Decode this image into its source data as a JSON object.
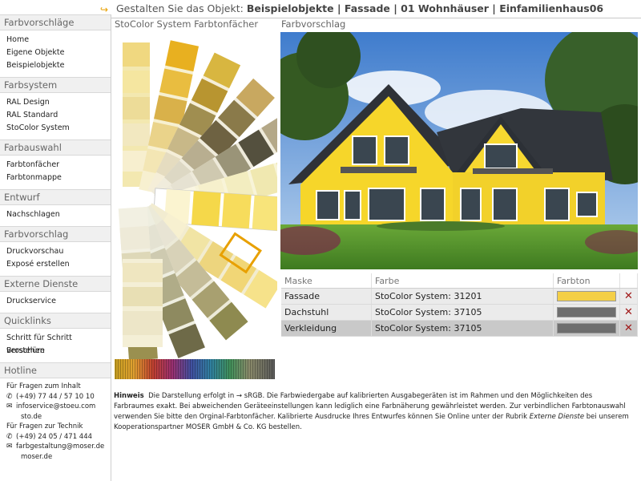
{
  "header": {
    "logo_icon": "arrow-link-icon",
    "title_prefix": "Gestalten Sie das Objekt: ",
    "title_path": "Beispielobjekte | Fassade | 01 Wohnhäuser | Einfamilienhaus06"
  },
  "sidebar": {
    "sections": [
      {
        "title": "Farbvorschläge",
        "items": [
          "Home",
          "Eigene Objekte",
          "Beispielobjekte"
        ]
      },
      {
        "title": "Farbsystem",
        "items": [
          "RAL Design",
          "RAL Standard",
          "StoColor System"
        ]
      },
      {
        "title": "Farbauswahl",
        "items": [
          "Farbtonfächer",
          "Farbtonmappe"
        ]
      },
      {
        "title": "Entwurf",
        "items": [
          "Nachschlagen"
        ]
      },
      {
        "title": "Farbvorschlag",
        "items": [
          "Druckvorschau",
          "Exposé erstellen"
        ]
      },
      {
        "title": "Externe Dienste",
        "items": [
          "Druckservice"
        ]
      },
      {
        "title": "Quicklinks",
        "items": [
          "Schritt für Schritt verstehen",
          "Broschüre"
        ]
      }
    ],
    "hotline": {
      "title": "Hotline",
      "content_label": "Für Fragen zum Inhalt",
      "content_phone": "(+49) 77 44 / 57 10 10",
      "content_email_1": "infoservice@stoeu.com",
      "content_email_2": "sto.de",
      "tech_label": "Für Fragen zur Technik",
      "tech_phone": "(+49) 24 05 / 471 444",
      "tech_email_1": "farbgestaltung@moser.de",
      "tech_email_2": "moser.de"
    }
  },
  "fan_panel": {
    "title": "StoColor System Farbtonfächer"
  },
  "preview": {
    "title": "Farbvorschlag"
  },
  "mask_table": {
    "headers": [
      "Maske",
      "Farbe",
      "Farbton",
      ""
    ],
    "rows": [
      {
        "mask": "Fassade",
        "color": "StoColor System: 31201",
        "swatch": "#f4cf47"
      },
      {
        "mask": "Dachstuhl",
        "color": "StoColor System: 37105",
        "swatch": "#6e6e6e"
      },
      {
        "mask": "Verkleidung",
        "color": "StoColor System: 37105",
        "swatch": "#6e6e6e"
      }
    ],
    "delete_icon": "close-x-icon"
  },
  "hint": {
    "label": "Hinweis",
    "part1": "Die Darstellung erfolgt in → sRGB. Die Farbwiedergabe auf kalibrierten Ausgabegeräten ist im Rahmen und den Möglichkeiten des Farbraumes exakt. Bei abweichenden Geräteeinstellungen kann lediglich eine Farbnäherung gewährleistet werden. Zur verbindlichen Farbtonauswahl verwenden Sie bitte den Orginal-Farbtonfächer. Kalibrierte Ausdrucke Ihres Entwurfes können Sie Online unter der Rubrik ",
    "link": "Externe Dienste",
    "part2": " bei unserem Kooperationspartner MOSER GmbH & Co. KG bestellen."
  },
  "colors": {
    "accent": "#e8a000",
    "facade_yellow": "#f4cf47",
    "roof_grey": "#6e6e6e",
    "delete_red": "#a01818"
  }
}
